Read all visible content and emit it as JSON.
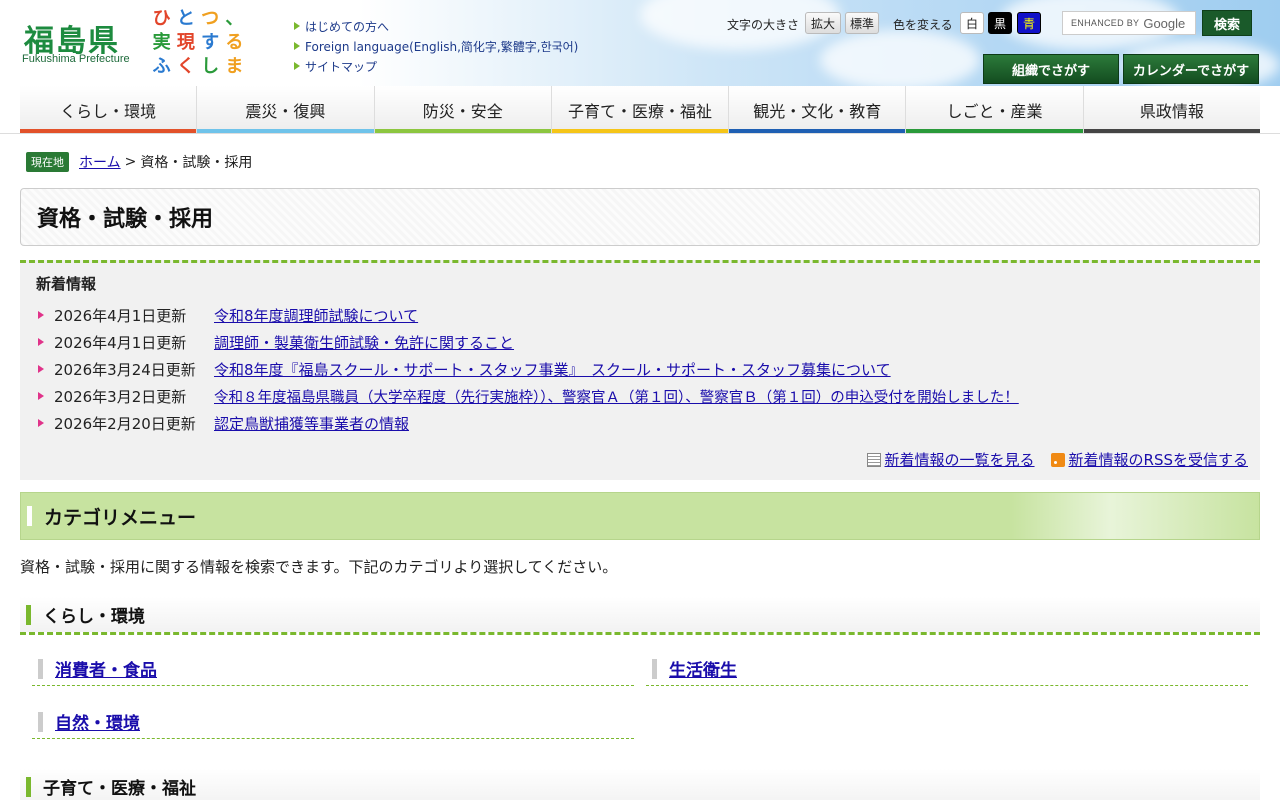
{
  "header": {
    "logo_jp": "福島県",
    "logo_en": "Fukushima Prefecture",
    "slogan_chars": [
      {
        "t": "ひ",
        "c": "#e2452a"
      },
      {
        "t": "と",
        "c": "#2a7ad0"
      },
      {
        "t": "つ",
        "c": "#f0a020"
      },
      {
        "t": "、",
        "c": "#2a9a3a"
      },
      {
        "t": "実",
        "c": "#2a9a3a"
      },
      {
        "t": "現",
        "c": "#e2452a"
      },
      {
        "t": "す",
        "c": "#2a7ad0"
      },
      {
        "t": "る",
        "c": "#f0a020"
      },
      {
        "t": "ふ",
        "c": "#2a7ad0"
      },
      {
        "t": "く",
        "c": "#e2452a"
      },
      {
        "t": "し",
        "c": "#2a9a3a"
      },
      {
        "t": "ま",
        "c": "#f0a020"
      }
    ],
    "links": [
      "はじめての方へ",
      "Foreign language(English,简化字,繁體字,한국어)",
      "サイトマップ"
    ],
    "text_size_label": "文字の大きさ",
    "enlarge": "拡大",
    "standard": "標準",
    "color_label": "色を変える",
    "color_white": "白",
    "color_black": "黒",
    "color_blue": "青",
    "search_enhanced": "ENHANCED BY",
    "search_google": "Google",
    "search_button": "検索",
    "org_search": "組織でさがす",
    "calendar_search": "カレンダーでさがす"
  },
  "nav": [
    {
      "label": "くらし・環境",
      "color": "#e2512a"
    },
    {
      "label": "震災・復興",
      "color": "#6fc3ea"
    },
    {
      "label": "防災・安全",
      "color": "#8cc63f"
    },
    {
      "label": "子育て・医療・福祉",
      "color": "#f5c518"
    },
    {
      "label": "観光・文化・教育",
      "color": "#1e5fb3"
    },
    {
      "label": "しごと・産業",
      "color": "#2a9a3a"
    },
    {
      "label": "県政情報",
      "color": "#444444"
    }
  ],
  "breadcrumb": {
    "badge": "現在地",
    "home": "ホーム",
    "separator": ">",
    "current": "資格・試験・採用"
  },
  "page_title": "資格・試験・採用",
  "news": {
    "title": "新着情報",
    "items": [
      {
        "date": "2026年4月1日更新",
        "link": "令和8年度調理師試験について"
      },
      {
        "date": "2026年4月1日更新",
        "link": "調理師・製菓衛生師試験・免許に関すること"
      },
      {
        "date": "2026年3月24日更新",
        "link": "令和8年度『福島スクール・サポート・スタッフ事業』　スクール・サポート・スタッフ募集について"
      },
      {
        "date": "2026年3月2日更新",
        "link": "令和８年度福島県職員（大学卒程度（先行実施枠））、警察官Ａ（第１回）、警察官Ｂ（第１回）の申込受付を開始しました！"
      },
      {
        "date": "2026年2月20日更新",
        "link": "認定鳥獣捕獲等事業者の情報"
      }
    ],
    "list_link": "新着情報の一覧を見る",
    "rss_link": "新着情報のRSSを受信する"
  },
  "category": {
    "title": "カテゴリメニュー",
    "description": "資格・試験・採用に関する情報を検索できます。下記のカテゴリより選択してください。",
    "sections": [
      {
        "title": "くらし・環境",
        "items": [
          "消費者・食品",
          "生活衛生",
          "自然・環境"
        ]
      },
      {
        "title": "子育て・医療・福祉",
        "items": []
      }
    ]
  }
}
